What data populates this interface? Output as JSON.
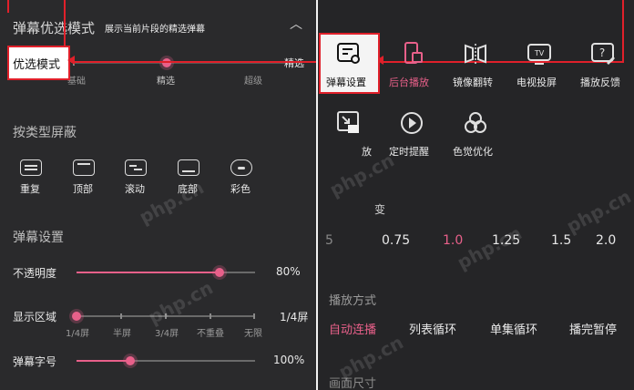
{
  "left": {
    "header_title": "弹幕优选模式",
    "header_subtitle": "展示当前片段的精选弹幕",
    "mode_highlight": "优选模式",
    "levels": [
      "基础",
      "精选",
      "超级"
    ],
    "selected_level": "精选",
    "type_block_title": "按类型屏蔽",
    "type_buttons": [
      {
        "label": "重复",
        "icon": "repeat-icon"
      },
      {
        "label": "顶部",
        "icon": "top-icon"
      },
      {
        "label": "滚动",
        "icon": "scroll-icon"
      },
      {
        "label": "底部",
        "icon": "bottom-icon"
      },
      {
        "label": "彩色",
        "icon": "palette-icon"
      }
    ],
    "settings_title": "弹幕设置",
    "opacity": {
      "label": "不透明度",
      "value_text": "80%",
      "fraction": 0.8
    },
    "area": {
      "label": "显示区域",
      "value_text": "1/4屏",
      "ticks": [
        "1/4屏",
        "半屏",
        "3/4屏",
        "不重叠",
        "无限"
      ],
      "position": 0
    },
    "fontsize": {
      "label": "弹幕字号",
      "value_text": "100%",
      "fraction": 0.3
    }
  },
  "right": {
    "menu_row1": [
      {
        "label": "弹幕设置",
        "icon": "danmaku-settings-icon"
      },
      {
        "label": "后台播放",
        "icon": "background-play-icon"
      },
      {
        "label": "镜像翻转",
        "icon": "mirror-flip-icon"
      },
      {
        "label": "电视投屏",
        "icon": "tv-cast-icon"
      },
      {
        "label": "播放反馈",
        "icon": "feedback-icon"
      }
    ],
    "menu_row2": [
      {
        "label": "放",
        "icon": "pip-icon"
      },
      {
        "label": "定时提醒",
        "icon": "timer-icon"
      },
      {
        "label": "色觉优化",
        "icon": "color-vision-icon"
      }
    ],
    "speed_label_fragment": "变",
    "speeds": [
      "5",
      "0.75",
      "1.0",
      "1.25",
      "1.5",
      "2.0"
    ],
    "selected_speed": "1.0",
    "playmode_title": "播放方式",
    "playmodes": [
      "自动连播",
      "列表循环",
      "单集循环",
      "播完暂停"
    ],
    "selected_playmode": "自动连播",
    "bottom_title": "画面尺寸",
    "watermark": "php.cn",
    "colors": {
      "accent": "#e8608a",
      "highlight_red": "#e0202a"
    }
  }
}
